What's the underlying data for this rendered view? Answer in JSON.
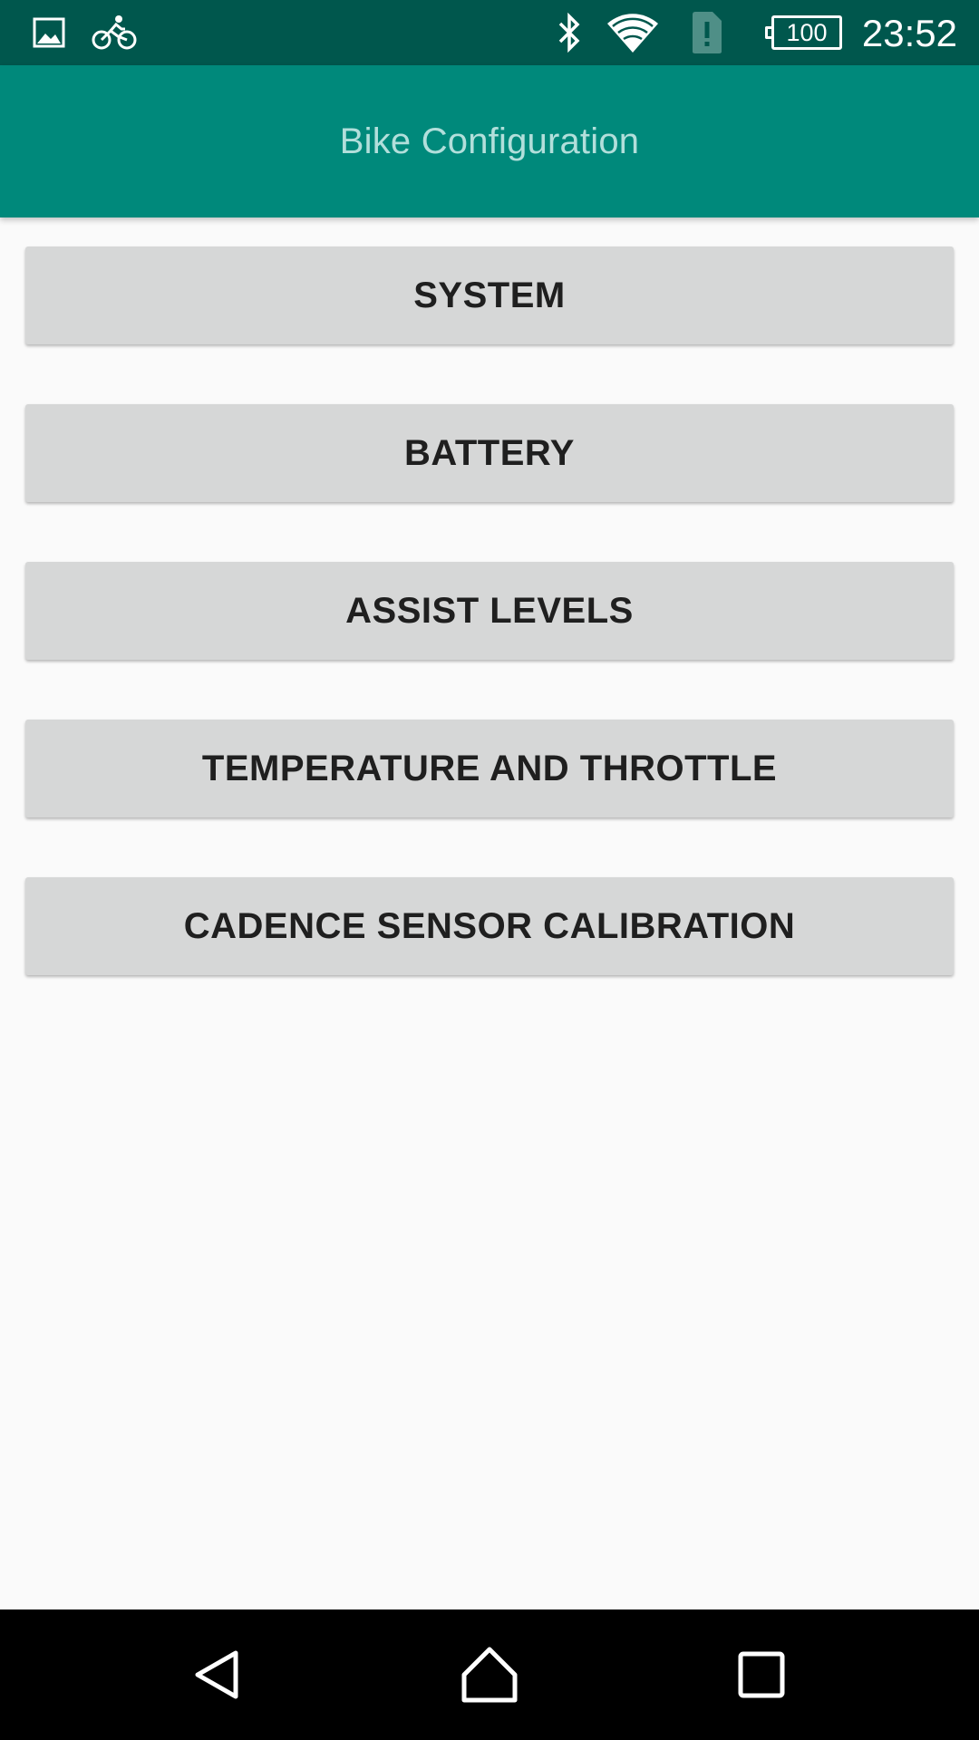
{
  "status_bar": {
    "icons": [
      "gallery-icon",
      "bike-icon",
      "bluetooth-icon",
      "wifi-icon",
      "sim-alert-icon",
      "battery-icon"
    ],
    "battery_level": "100",
    "time": "23:52"
  },
  "app_bar": {
    "title": "Bike Configuration"
  },
  "menu": {
    "items": [
      {
        "label": "SYSTEM"
      },
      {
        "label": "BATTERY"
      },
      {
        "label": "ASSIST LEVELS"
      },
      {
        "label": "TEMPERATURE AND THROTTLE"
      },
      {
        "label": "CADENCE SENSOR CALIBRATION"
      }
    ]
  },
  "nav_bar": {
    "icons": [
      "back-icon",
      "home-icon",
      "recents-icon"
    ]
  },
  "colors": {
    "status_bar": "#00574d",
    "app_bar": "#00897b",
    "title_text": "#b2dfdb",
    "button_bg": "#d6d7d7",
    "background": "#fafafa"
  }
}
